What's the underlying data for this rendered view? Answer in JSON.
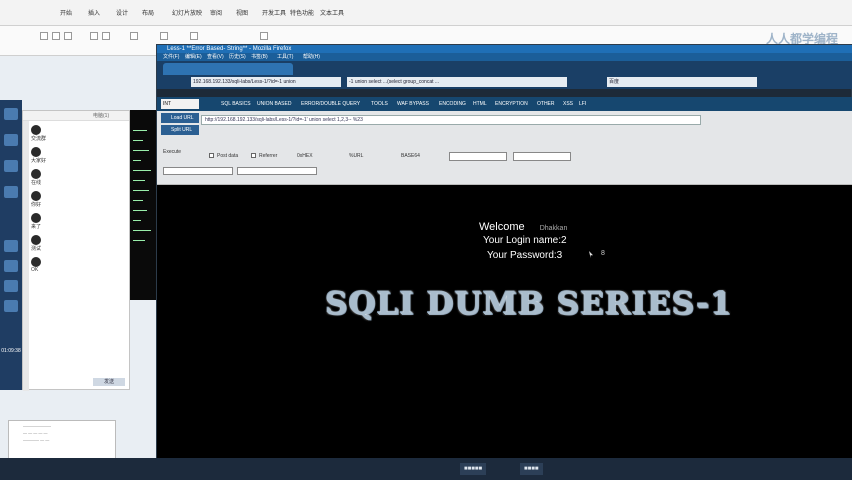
{
  "office": {
    "tabs": [
      "开始",
      "插入",
      "设计",
      "布局",
      "幻灯片放映",
      "审阅",
      "视图",
      "开发工具",
      "特色功能",
      "文本工具"
    ],
    "watermark": "人人都学编程"
  },
  "qq": {
    "time": "01:09:38",
    "chat_header": "电脑(1)",
    "messages": [
      "交流群",
      "大家好",
      "在线",
      "你好",
      "来了",
      "测试",
      "OK"
    ],
    "send_button": "发送"
  },
  "browser": {
    "title": "Less-1 **Error Based- String** - Mozilla Firefox",
    "menu": [
      "文件(F)",
      "编辑(E)",
      "查看(V)",
      "历史(S)",
      "书签(B)",
      "工具(T)",
      "帮助(H)"
    ],
    "url": "192.168.192.133/sqli-labs/Less-1/?id=-1 union ",
    "search": "-1 union select ...(select group_concat ...",
    "search_engine": "百度"
  },
  "hackbar": {
    "select": "INT",
    "menu": [
      "SQL BASICS",
      "UNION BASED",
      "ERROR/DOUBLE QUERY",
      "TOOLS",
      "WAF BYPASS",
      "ENCODING",
      "HTML",
      "ENCRYPTION",
      "OTHER",
      "XSS",
      "LFI"
    ],
    "load_url": "Load URL",
    "split_url": "Split URL",
    "execute": "Execute",
    "url_value": "http://192.168.192.133/sqli-labs/Less-1/?id=-1' union select 1,2,3-- %23",
    "options": [
      "Post data",
      "Referrer",
      "0xHEX",
      "%URL",
      "BASE64"
    ]
  },
  "page": {
    "welcome_label": "Welcome",
    "welcome_name": "Dhakkan",
    "login_name": "Your Login name:2",
    "password": "Your Password:3",
    "extra": "8",
    "banner": "SQLI DUMB SERIES-1"
  }
}
